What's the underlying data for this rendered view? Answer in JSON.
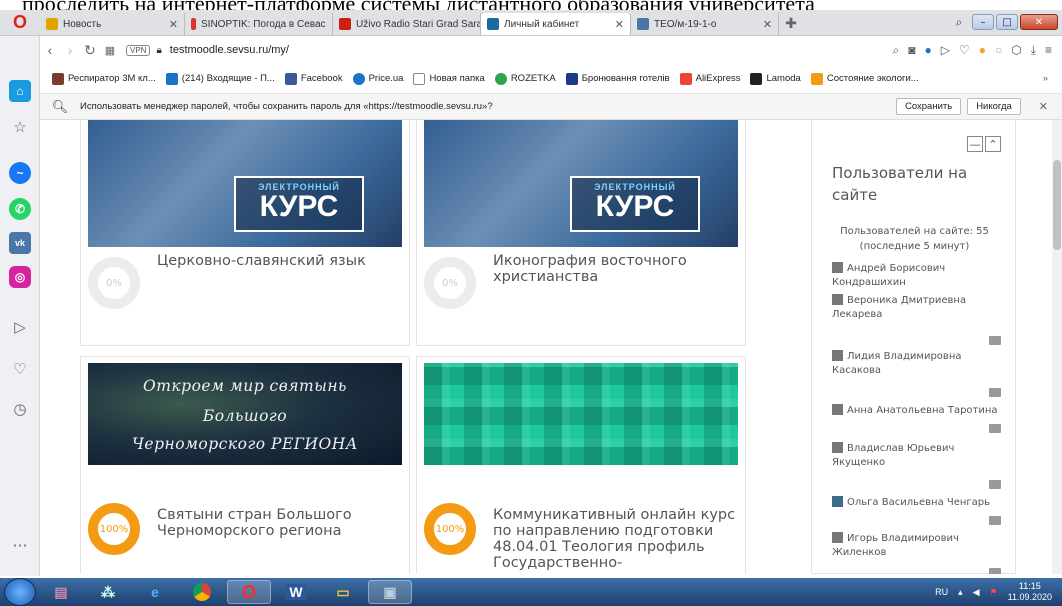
{
  "doc_text": "проследить на интернет-платформе системы дистантного образования университета",
  "browser": {
    "logo": "O",
    "tabs": [
      {
        "label": "Новость",
        "color": "#e0a400",
        "active": false
      },
      {
        "label": "SINOPTIK: Погода в Севас",
        "color": "#d33",
        "active": false
      },
      {
        "label": "Uživo Radio Stari Grad Sara",
        "color": "#c21",
        "active": false
      },
      {
        "label": "Личный кабинет",
        "color": "#1c6aa0",
        "active": true
      },
      {
        "label": "ТЕО/м-19-1-о",
        "color": "#4a76a8",
        "active": false
      }
    ],
    "url": "testmoodle.sevsu.ru/my/",
    "vpn_label": "VPN",
    "bookmarks": [
      {
        "label": "Респиратор 3М кл...",
        "color": "#7b3a2e"
      },
      {
        "label": "(214) Входящие - П...",
        "color": "#1a73c7"
      },
      {
        "label": "Facebook",
        "color": "#3b5998"
      },
      {
        "label": "Price.ua",
        "color": "#1a73c7"
      },
      {
        "label": "Новая папка",
        "color": "#888888"
      },
      {
        "label": "ROZETKA",
        "color": "#2ea44f"
      },
      {
        "label": "Бронювання готелів",
        "color": "#1a3b8a"
      },
      {
        "label": "AliExpress",
        "color": "#e43"
      },
      {
        "label": "Lamoda",
        "color": "#222"
      },
      {
        "label": "Состояние экологи...",
        "color": "#f29b13"
      }
    ],
    "password_bar": {
      "text": "Использовать менеджер паролей, чтобы сохранить пароль для «https://testmoodle.sevsu.ru»?",
      "save": "Сохранить",
      "never": "Никогда"
    }
  },
  "courses": [
    {
      "title": "Церковно-славянский язык",
      "progress_label": "0%",
      "progress": 0,
      "image": "electronic-course",
      "kurs_small": "ЭЛЕКТРОННЫЙ",
      "kurs_big": "КУРС"
    },
    {
      "title": "Иконография восточного христианства",
      "progress_label": "0%",
      "progress": 0,
      "image": "electronic-course",
      "kurs_small": "ЭЛЕКТРОННЫЙ",
      "kurs_big": "КУРС"
    },
    {
      "title": "Святыни стран Большого Черноморского региона",
      "progress_label": "100%",
      "progress": 100,
      "image": "black-sea",
      "banner_lines": [
        "Откроем мир святынь",
        "Большого",
        "Черноморского РЕГИОНА"
      ]
    },
    {
      "title": "Коммуникативный онлайн курс по направлению подготовки 48.04.01 Теология профиль Государственно-",
      "progress_label": "100%",
      "progress": 100,
      "image": "plaid"
    }
  ],
  "online_users": {
    "title": "Пользователи на сайте",
    "stat_line1": "Пользователей на сайте: 55",
    "stat_line2": "(последние 5 минут)",
    "users": [
      "Андрей Борисович Кондрашихин",
      "Вероника Дмитриевна Лекарева",
      "Лидия Владимировна Касакова",
      "Анна Анатольевна Таротина",
      "Владислав Юрьевич Якущенко",
      "Ольга Васильевна Ченгарь",
      "Игорь Владимирович Жиленков"
    ]
  },
  "taskbar": {
    "lang": "RU",
    "time": "11:15",
    "date": "11.09.2020"
  }
}
